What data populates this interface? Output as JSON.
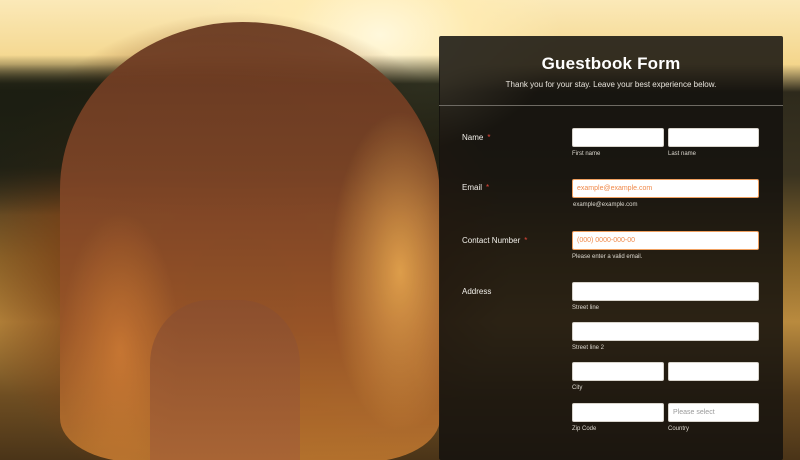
{
  "form": {
    "title": "Guestbook Form",
    "subtitle": "Thank you for your stay. Leave your best experience below."
  },
  "name": {
    "label": "Name",
    "required_mark": "*",
    "first_sublabel": "First name",
    "last_sublabel": "Last name",
    "first_value": "",
    "last_value": ""
  },
  "email": {
    "label": "Email",
    "required_mark": "*",
    "placeholder": "example@example.com",
    "sublabel": "example@example.com"
  },
  "contact": {
    "label": "Contact Number",
    "required_mark": "*",
    "placeholder": "(000) 0000-000-00",
    "sublabel": "Please enter a valid email."
  },
  "address": {
    "label": "Address",
    "street1_sublabel": "Street line",
    "street2_sublabel": "Street line 2",
    "city_sublabel": "City",
    "zip_sublabel": "Zip Code",
    "country_sublabel": "Country",
    "country_placeholder": "Please select"
  },
  "colors": {
    "panel_bg": "#14120e",
    "required": "#e0473a",
    "placeholder_accent": "#f08a4b"
  }
}
